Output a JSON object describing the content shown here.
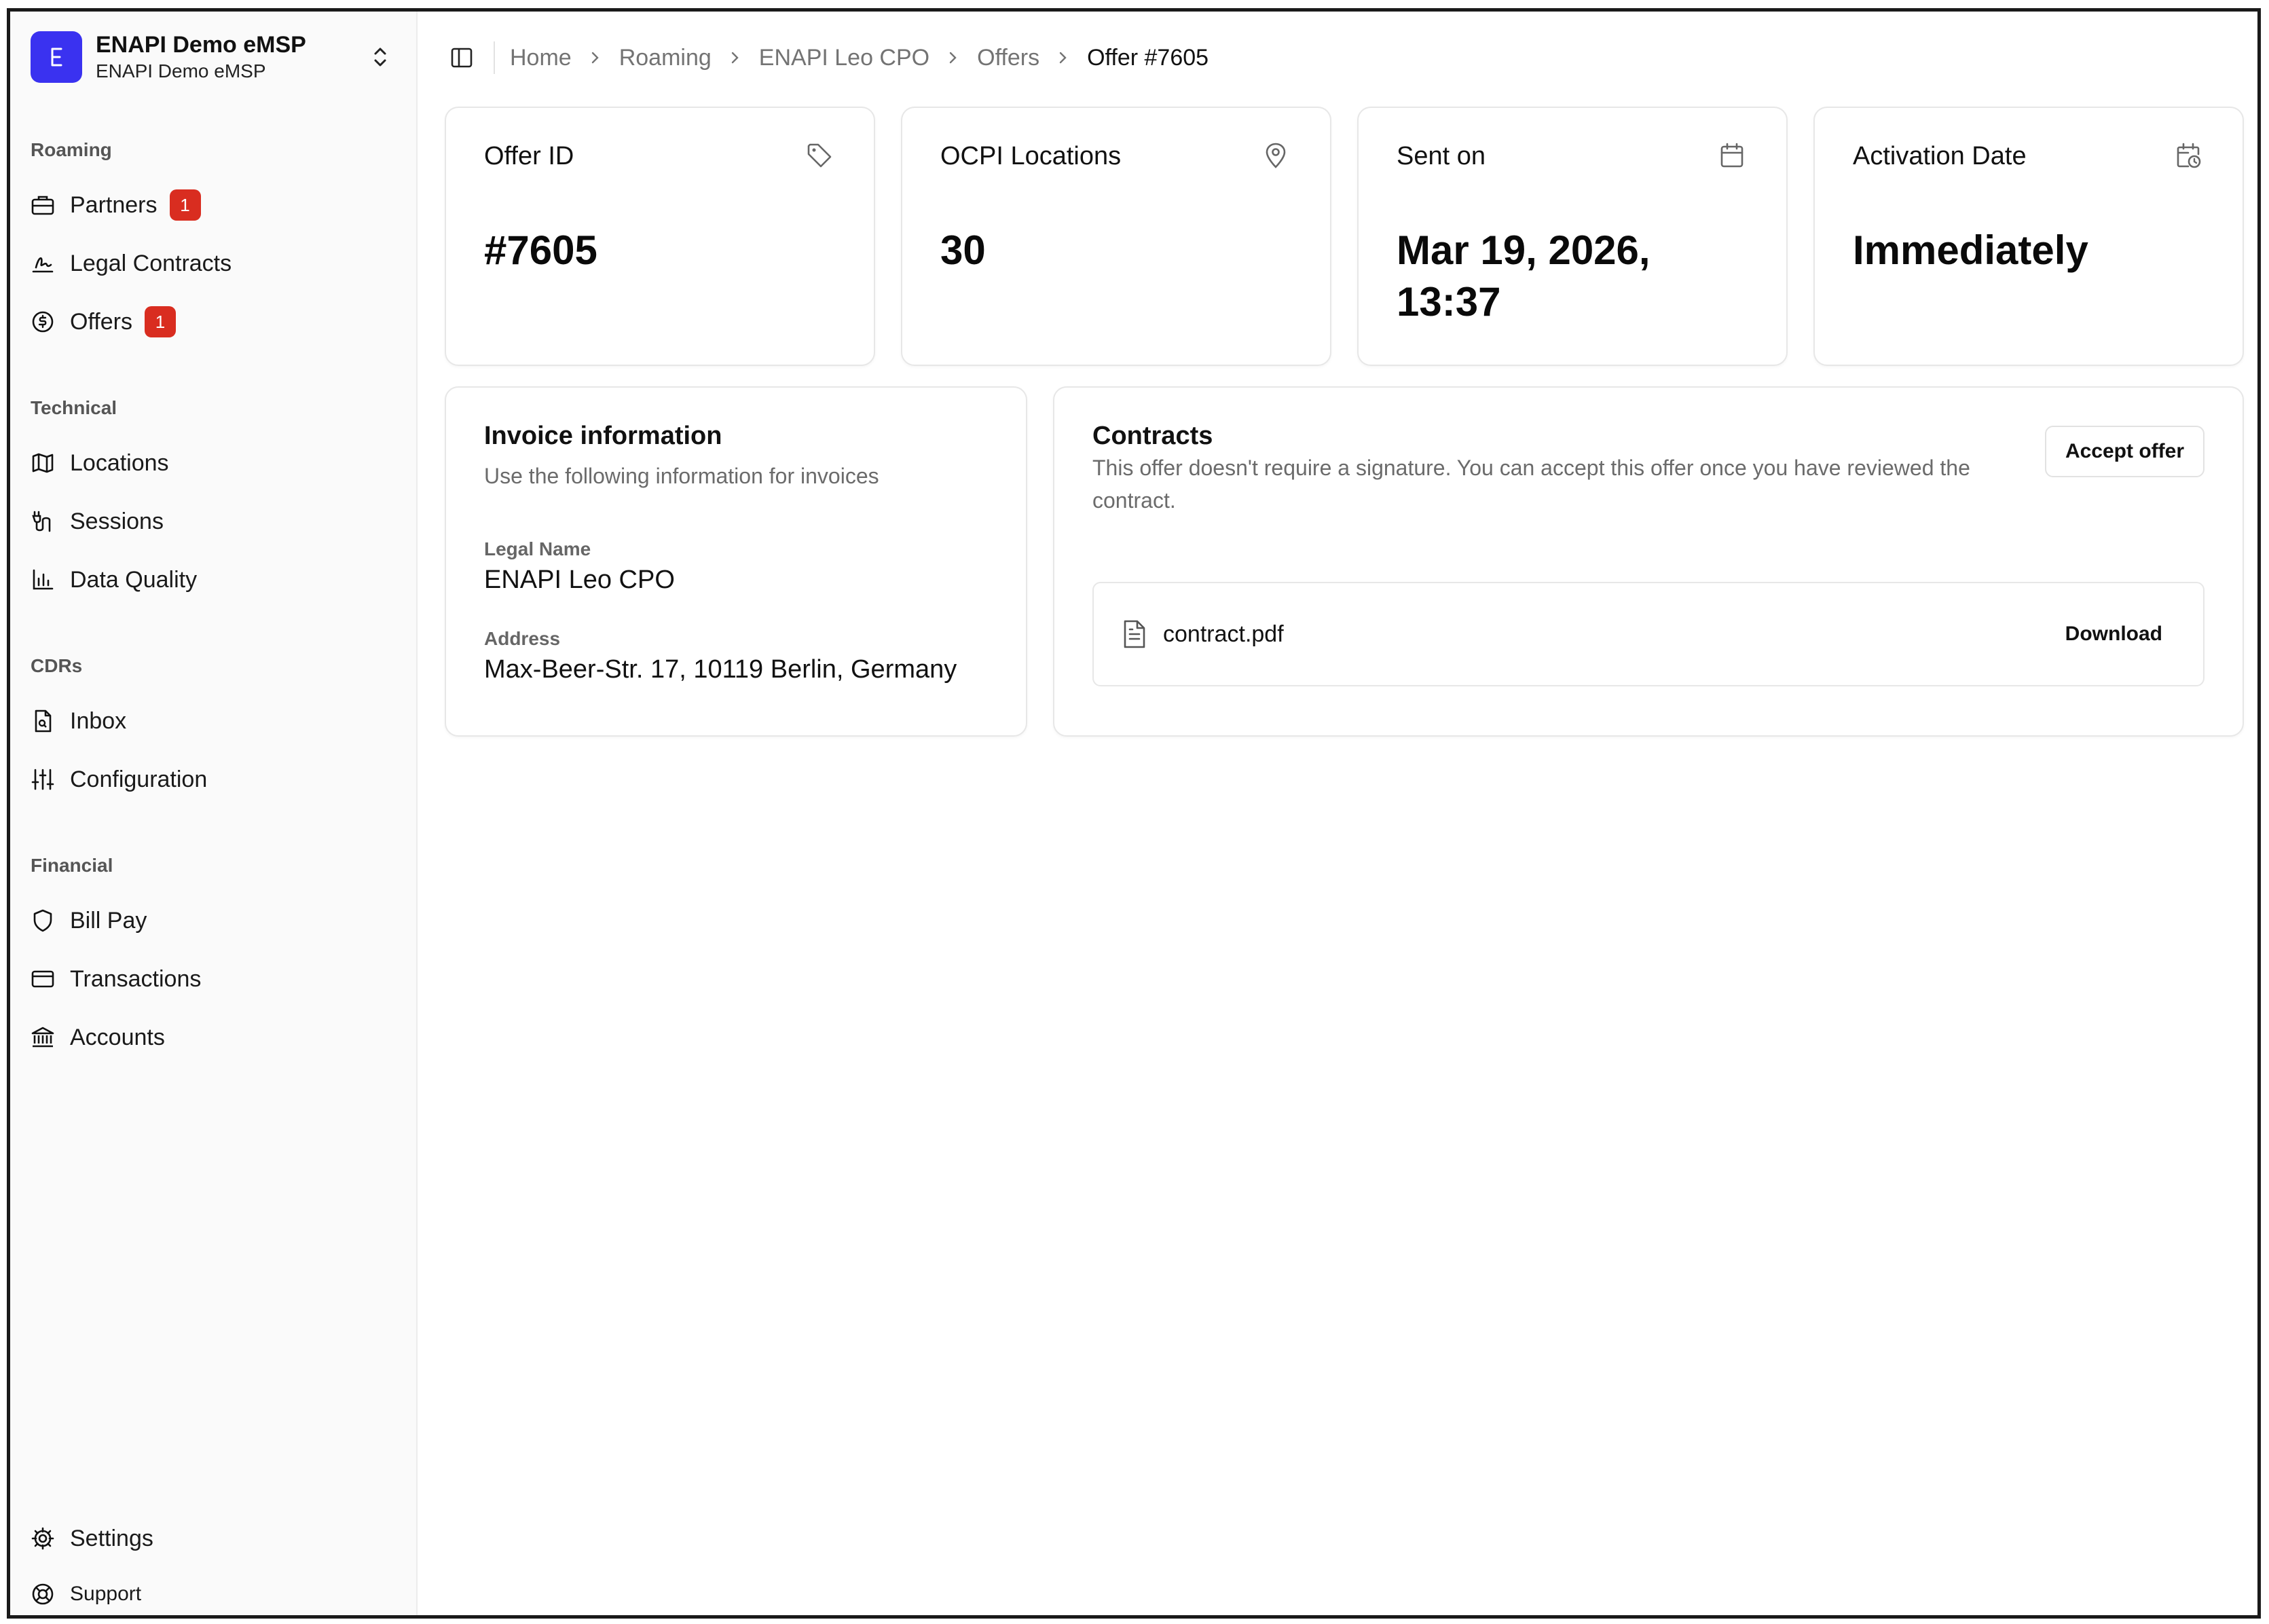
{
  "org": {
    "title": "ENAPI Demo eMSP",
    "subtitle": "ENAPI Demo eMSP",
    "logo_letter": "E",
    "brand_color": "#3a32f0"
  },
  "sidebar": {
    "sections": [
      {
        "label": "Roaming",
        "items": [
          {
            "label": "Partners",
            "icon": "briefcase-icon",
            "badge": "1"
          },
          {
            "label": "Legal Contracts",
            "icon": "signature-icon"
          },
          {
            "label": "Offers",
            "icon": "dollar-circle-icon",
            "badge": "1"
          }
        ]
      },
      {
        "label": "Technical",
        "items": [
          {
            "label": "Locations",
            "icon": "map-icon"
          },
          {
            "label": "Sessions",
            "icon": "charging-plug-icon"
          },
          {
            "label": "Data Quality",
            "icon": "bar-chart-icon"
          }
        ]
      },
      {
        "label": "CDRs",
        "items": [
          {
            "label": "Inbox",
            "icon": "file-search-icon"
          },
          {
            "label": "Configuration",
            "icon": "sliders-icon"
          }
        ]
      },
      {
        "label": "Financial",
        "items": [
          {
            "label": "Bill Pay",
            "icon": "shield-icon"
          },
          {
            "label": "Transactions",
            "icon": "credit-card-icon"
          },
          {
            "label": "Accounts",
            "icon": "bank-icon"
          }
        ]
      }
    ],
    "footer": [
      {
        "label": "Settings",
        "icon": "gear-icon"
      },
      {
        "label": "Support",
        "icon": "life-buoy-icon"
      }
    ]
  },
  "breadcrumb": [
    "Home",
    "Roaming",
    "ENAPI Leo CPO",
    "Offers",
    "Offer #7605"
  ],
  "stats": [
    {
      "title": "Offer ID",
      "value": "#7605",
      "icon": "tag-icon"
    },
    {
      "title": "OCPI Locations",
      "value": "30",
      "icon": "map-pin-icon"
    },
    {
      "title": "Sent on",
      "value": "Mar 19, 2026, 13:37",
      "icon": "calendar-icon"
    },
    {
      "title": "Activation Date",
      "value": "Immediately",
      "icon": "calendar-clock-icon"
    }
  ],
  "invoice": {
    "title": "Invoice information",
    "subtitle": "Use the following information for invoices",
    "legal_name_label": "Legal Name",
    "legal_name": "ENAPI Leo CPO",
    "address_label": "Address",
    "address": "Max-Beer-Str. 17, 10119 Berlin, Germany"
  },
  "contracts": {
    "title": "Contracts",
    "description": "This offer doesn't require a signature. You can accept this offer once you have reviewed the contract.",
    "accept_label": "Accept offer",
    "file_name": "contract.pdf",
    "download_label": "Download"
  },
  "colors": {
    "badge": "#d92d20",
    "muted_text": "#6b6b6b",
    "border": "#e7e7e7"
  }
}
